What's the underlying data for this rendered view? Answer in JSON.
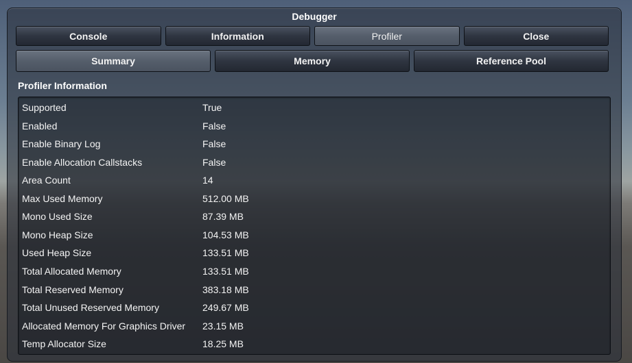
{
  "window": {
    "title": "Debugger"
  },
  "top_tabs": [
    {
      "label": "Console"
    },
    {
      "label": "Information"
    },
    {
      "label": "Profiler"
    },
    {
      "label": "Close"
    }
  ],
  "sub_tabs": [
    {
      "label": "Summary"
    },
    {
      "label": "Memory"
    },
    {
      "label": "Reference Pool"
    }
  ],
  "section": {
    "label": "Profiler Information"
  },
  "rows": [
    {
      "key": "Supported",
      "value": "True"
    },
    {
      "key": "Enabled",
      "value": "False"
    },
    {
      "key": "Enable Binary Log",
      "value": "False"
    },
    {
      "key": "Enable Allocation Callstacks",
      "value": "False"
    },
    {
      "key": "Area Count",
      "value": "14"
    },
    {
      "key": "Max Used Memory",
      "value": "512.00 MB"
    },
    {
      "key": "Mono Used Size",
      "value": "87.39 MB"
    },
    {
      "key": "Mono Heap Size",
      "value": "104.53 MB"
    },
    {
      "key": "Used Heap Size",
      "value": "133.51 MB"
    },
    {
      "key": "Total Allocated Memory",
      "value": "133.51 MB"
    },
    {
      "key": "Total Reserved Memory",
      "value": "383.18 MB"
    },
    {
      "key": "Total Unused Reserved Memory",
      "value": "249.67 MB"
    },
    {
      "key": "Allocated Memory For Graphics Driver",
      "value": "23.15 MB"
    },
    {
      "key": "Temp Allocator Size",
      "value": "18.25 MB"
    }
  ]
}
